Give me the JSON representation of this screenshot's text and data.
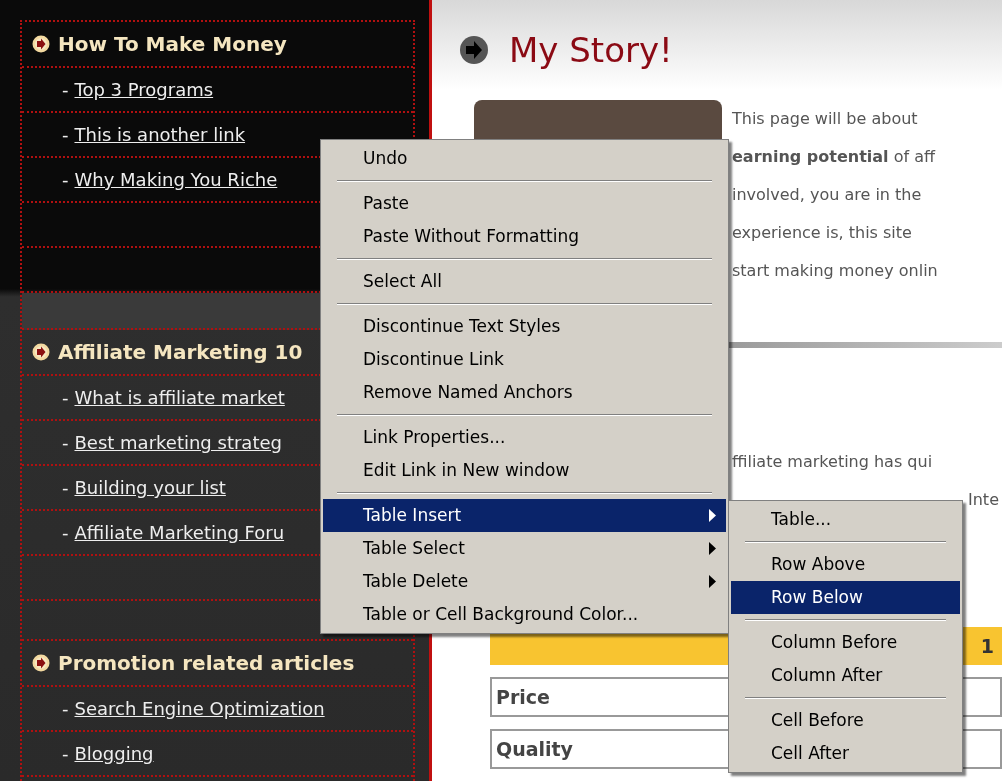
{
  "sidebar": {
    "sections": [
      {
        "title": "How To Make Money",
        "links": [
          {
            "prefix": "-",
            "label": "Top 3 Programs"
          },
          {
            "prefix": "-",
            "label": "This is another link"
          },
          {
            "prefix": "-",
            "label": "Why Making You Riche"
          }
        ]
      },
      {
        "title": "Affiliate Marketing 10",
        "links": [
          {
            "prefix": "-",
            "label": "What is affiliate market"
          },
          {
            "prefix": "-",
            "label": "Best marketing strateg"
          },
          {
            "prefix": "-",
            "label": "Building your list"
          },
          {
            "prefix": "-",
            "label": "Affiliate Marketing Foru"
          }
        ]
      },
      {
        "title": "Promotion related articles",
        "links": [
          {
            "prefix": "-",
            "label": "Search Engine Optimization"
          },
          {
            "prefix": "-",
            "label": "Blogging"
          }
        ]
      }
    ]
  },
  "content": {
    "heading": "My Story!",
    "intro_lines": [
      "This page will be about",
      "**earning potential** of aff",
      "involved, you are in the",
      "experience is, this site",
      "start making money onlin"
    ],
    "second_line": "ffiliate marketing has qui",
    "cut_word": "Inte",
    "table": {
      "header_cell": "1",
      "rows": [
        {
          "label": "Price"
        },
        {
          "label": "Quality"
        }
      ]
    }
  },
  "context_menu": {
    "items": [
      {
        "kind": "item",
        "label": "Undo",
        "selected": false,
        "submenu": false
      },
      {
        "kind": "separator"
      },
      {
        "kind": "item",
        "label": "Paste",
        "selected": false,
        "submenu": false
      },
      {
        "kind": "item",
        "label": "Paste Without Formatting",
        "selected": false,
        "submenu": false
      },
      {
        "kind": "separator"
      },
      {
        "kind": "item",
        "label": "Select All",
        "selected": false,
        "submenu": false
      },
      {
        "kind": "separator"
      },
      {
        "kind": "item",
        "label": "Discontinue Text Styles",
        "selected": false,
        "submenu": false
      },
      {
        "kind": "item",
        "label": "Discontinue Link",
        "selected": false,
        "submenu": false
      },
      {
        "kind": "item",
        "label": "Remove Named Anchors",
        "selected": false,
        "submenu": false
      },
      {
        "kind": "separator"
      },
      {
        "kind": "item",
        "label": "Link Properties...",
        "selected": false,
        "submenu": false
      },
      {
        "kind": "item",
        "label": "Edit Link in New window",
        "selected": false,
        "submenu": false
      },
      {
        "kind": "separator"
      },
      {
        "kind": "item",
        "label": "Table Insert",
        "selected": true,
        "submenu": true
      },
      {
        "kind": "item",
        "label": "Table Select",
        "selected": false,
        "submenu": true
      },
      {
        "kind": "item",
        "label": "Table Delete",
        "selected": false,
        "submenu": true
      },
      {
        "kind": "item",
        "label": "Table or Cell Background Color...",
        "selected": false,
        "submenu": false
      }
    ]
  },
  "submenu": {
    "items": [
      {
        "kind": "item",
        "label": "Table...",
        "selected": false,
        "submenu": false
      },
      {
        "kind": "separator"
      },
      {
        "kind": "item",
        "label": "Row Above",
        "selected": false,
        "submenu": false
      },
      {
        "kind": "item",
        "label": "Row Below",
        "selected": true,
        "submenu": false
      },
      {
        "kind": "separator"
      },
      {
        "kind": "item",
        "label": "Column Before",
        "selected": false,
        "submenu": false
      },
      {
        "kind": "item",
        "label": "Column After",
        "selected": false,
        "submenu": false
      },
      {
        "kind": "separator"
      },
      {
        "kind": "item",
        "label": "Cell Before",
        "selected": false,
        "submenu": false
      },
      {
        "kind": "item",
        "label": "Cell After",
        "selected": false,
        "submenu": false
      }
    ]
  }
}
